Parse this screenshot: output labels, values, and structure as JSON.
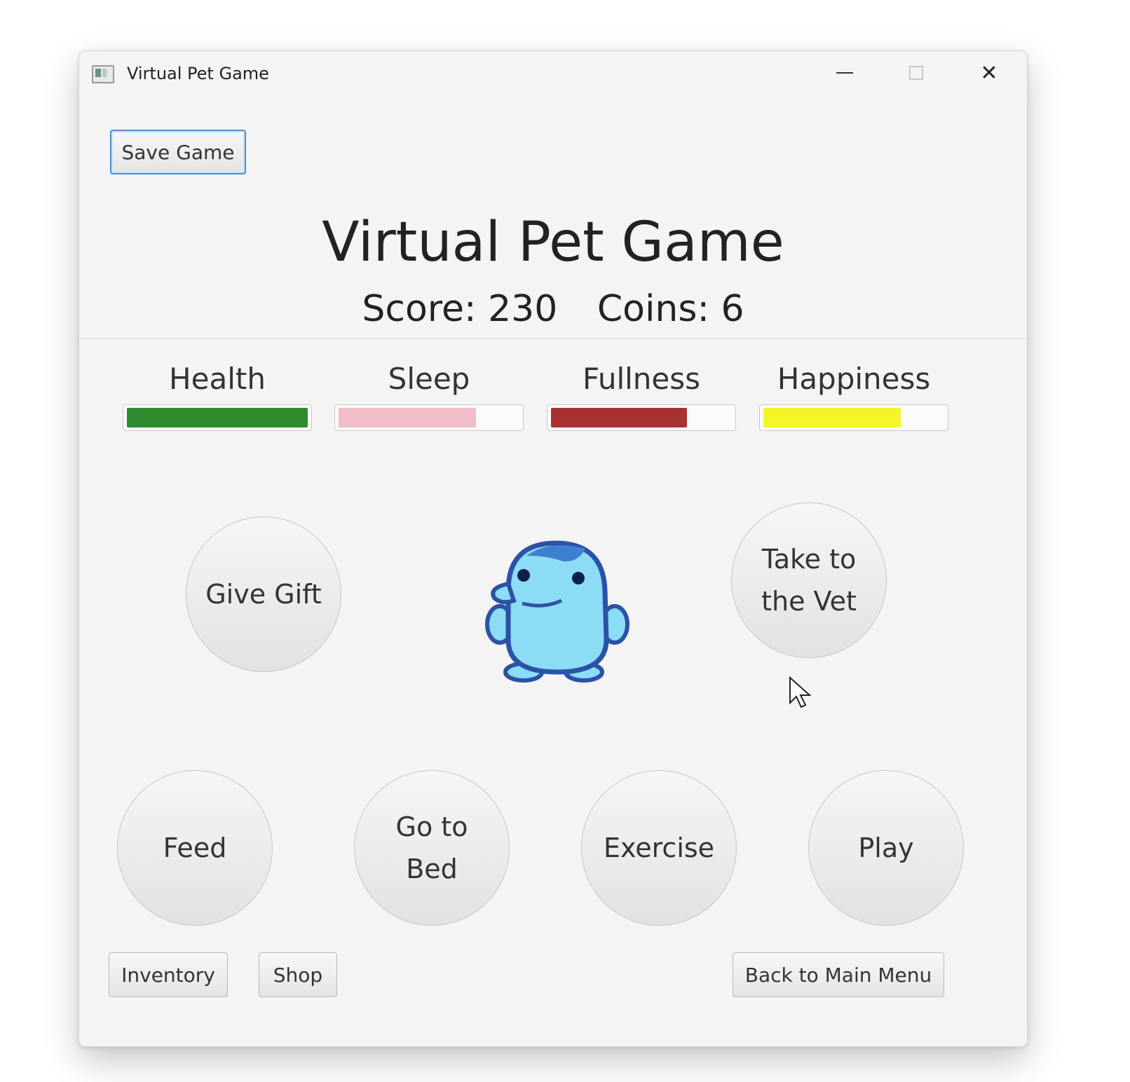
{
  "window": {
    "title": "Virtual Pet Game"
  },
  "toolbar": {
    "save_label": "Save Game"
  },
  "header": {
    "title": "Virtual Pet Game",
    "score_text": "Score: 230",
    "coins_text": "Coins: 6",
    "score": 230,
    "coins": 6
  },
  "stats": [
    {
      "label": "Health",
      "fill_percent": 100,
      "color": "#2e8b2e"
    },
    {
      "label": "Sleep",
      "fill_percent": 76,
      "color": "#f2bcc9"
    },
    {
      "label": "Fullness",
      "fill_percent": 75,
      "color": "#a83232"
    },
    {
      "label": "Happiness",
      "fill_percent": 76,
      "color": "#f5f52a"
    }
  ],
  "actions": {
    "give_gift": "Give Gift",
    "vet": "Take to the Vet",
    "feed": "Feed",
    "bed": "Go to Bed",
    "exercise": "Exercise",
    "play": "Play"
  },
  "footer": {
    "inventory": "Inventory",
    "shop": "Shop",
    "main_menu": "Back to Main Menu"
  }
}
